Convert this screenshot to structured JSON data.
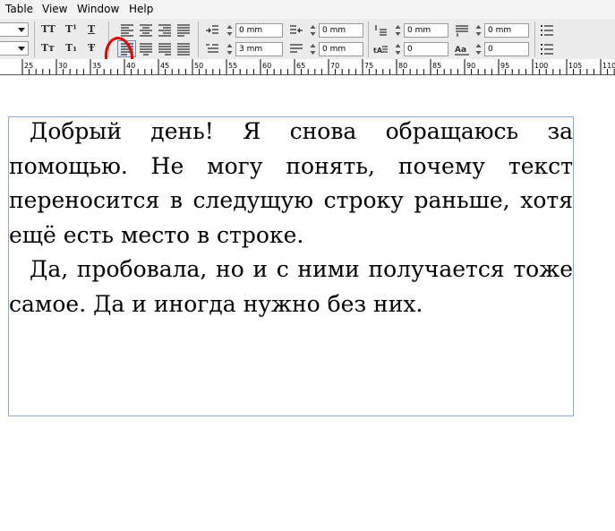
{
  "menubar": {
    "items": [
      {
        "label": "Table"
      },
      {
        "label": "View"
      },
      {
        "label": "Window"
      },
      {
        "label": "Help"
      }
    ]
  },
  "toolbar": {
    "fields": {
      "left_indent": "0 mm",
      "first_line_indent": "3 mm",
      "right_indent": "0 mm",
      "last_line_indent": "0 mm",
      "space_before": "0 mm",
      "space_after": "0 mm",
      "drop_cap_lines": "0",
      "drop_cap_chars": "0"
    },
    "icons": [
      "all-caps-icon",
      "superscript-icon",
      "underline-icon",
      "small-caps-icon",
      "subscript-icon",
      "strikethrough-icon",
      "align-left-icon",
      "align-center-icon",
      "align-right-icon",
      "align-justify-icon",
      "justify-last-left-icon",
      "justify-last-center-icon",
      "justify-last-right-icon",
      "justify-all-icon"
    ],
    "glyphs": {
      "all_caps": "TT",
      "superscript": "T¹",
      "underline": "T",
      "small_caps": "Tт",
      "subscript": "T₁",
      "strikethrough": "Ŧ"
    },
    "highlight_color": "#e00000"
  },
  "ruler": {
    "labels": [
      "25",
      "30",
      "35",
      "40",
      "45",
      "50",
      "55",
      "60",
      "65",
      "70",
      "75",
      "80",
      "85",
      "90",
      "95",
      "100",
      "105",
      "110"
    ]
  },
  "document": {
    "paragraphs": [
      "Добрый день! Я снова обращаюсь за помощью. Не могу понять, почему текст переносится в следущую строку раньше, хотя ещё есть место в строке.",
      "Да, пробовала, но и с ними получается тоже самое. Да и иногда нужно без них."
    ],
    "frame_color": "#8fa9d6"
  }
}
